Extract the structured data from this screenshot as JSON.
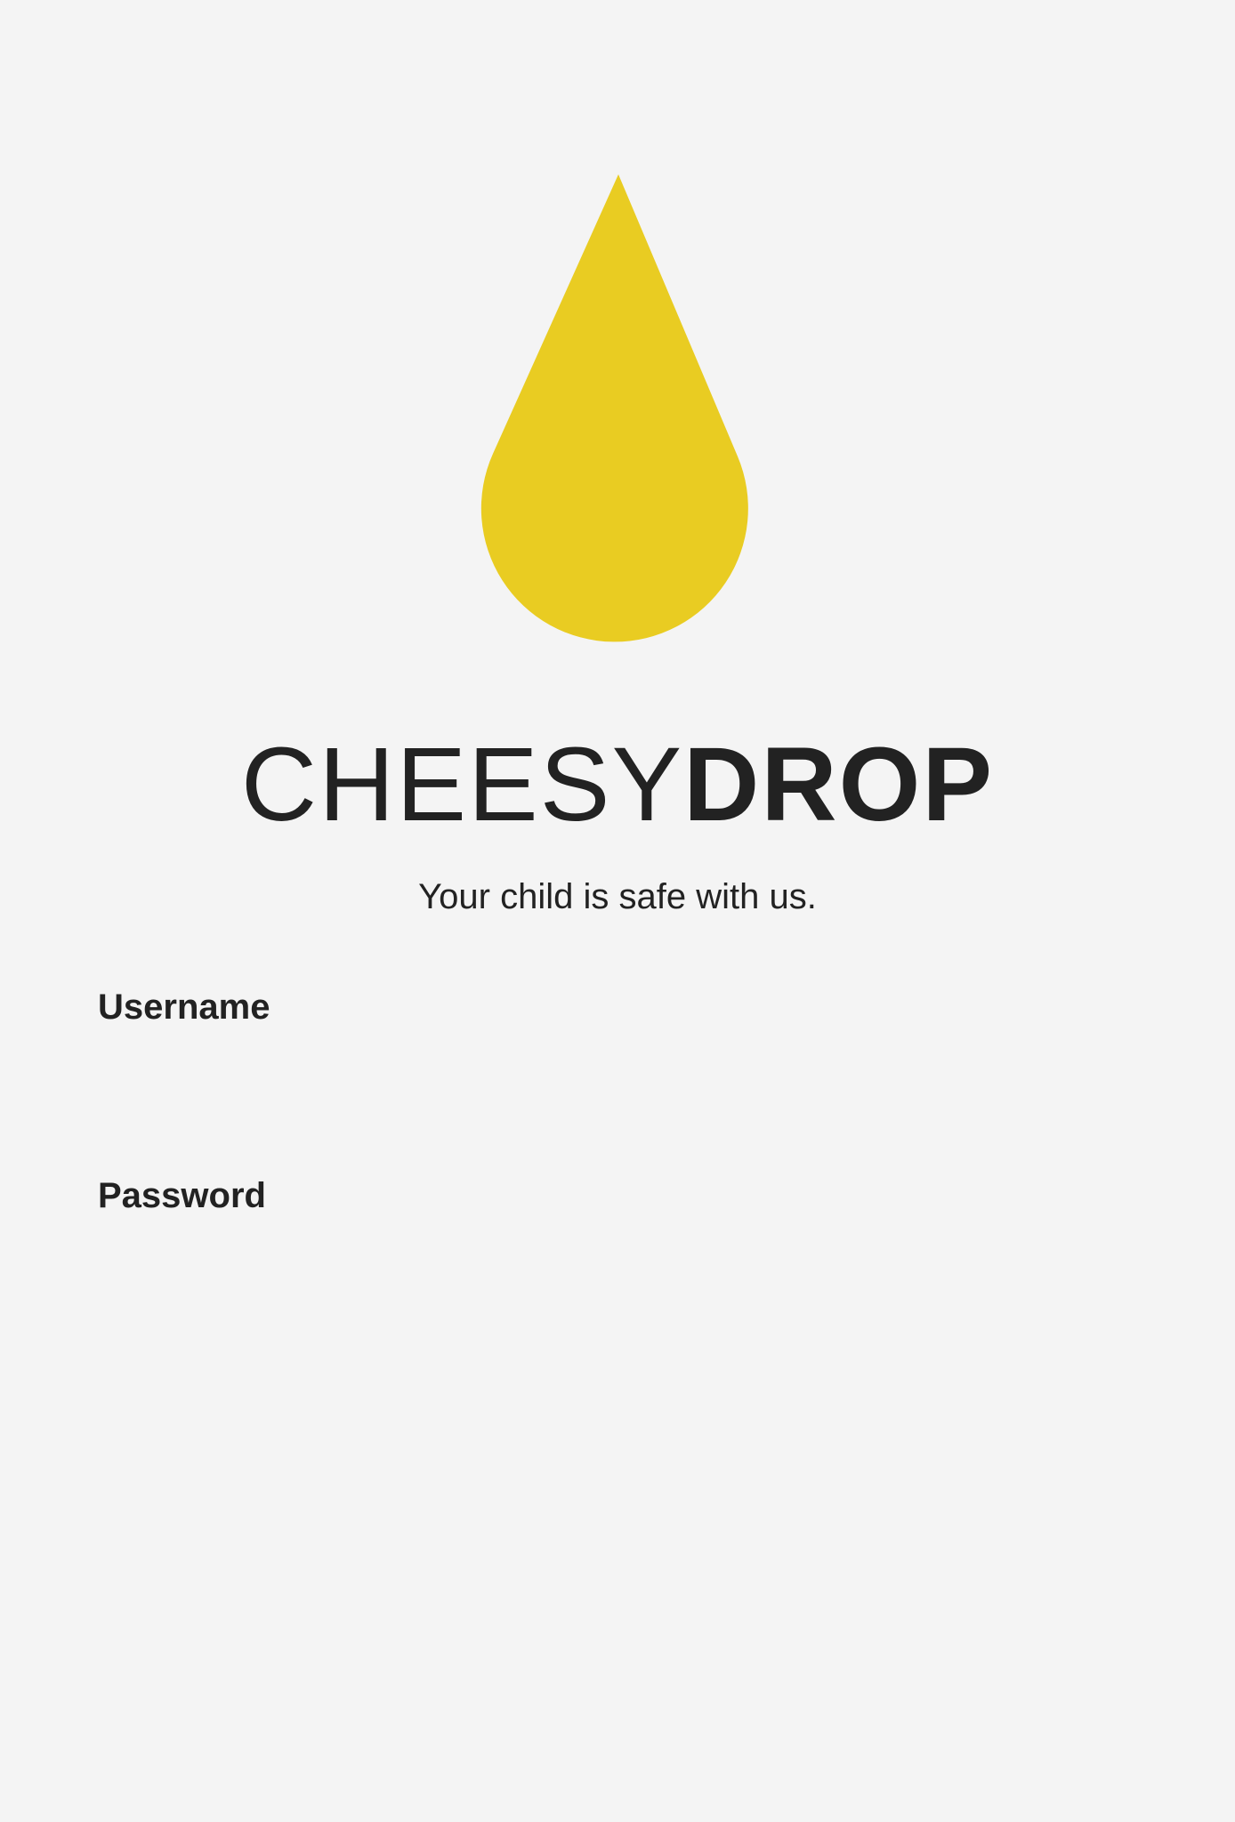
{
  "brand": {
    "name_light": "CHEESY",
    "name_bold": "DROP",
    "tagline": "Your child is safe with us.",
    "logo_icon": "cheese-drop-icon",
    "accent_color": "#e9cc22"
  },
  "form": {
    "username": {
      "label": "Username",
      "value": ""
    },
    "password": {
      "label": "Password",
      "value": ""
    }
  }
}
